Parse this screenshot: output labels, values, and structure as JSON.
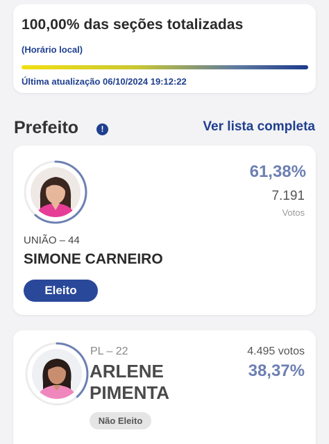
{
  "status": {
    "title": "100,00% das seções totalizadas",
    "local_time_label": "(Horário local)",
    "progress_percent": 100,
    "last_update": "Última atualização 06/10/2024 19:12:22",
    "progress_gradient": [
      "#f2df12",
      "#1c3a8c"
    ]
  },
  "section": {
    "title": "Prefeito",
    "info_icon": "info-icon",
    "see_all_label": "Ver lista completa"
  },
  "candidates": [
    {
      "party": "UNIÃO – 44",
      "name": "SIMONE CARNEIRO",
      "percent": "61,38%",
      "votes": "7.191",
      "votes_label": "Votos",
      "status_label": "Eleito",
      "ring_fraction": 0.6138,
      "ring_color": "#6d80b3"
    },
    {
      "party": "PL – 22",
      "name_line1": "ARLENE",
      "name_line2": "PIMENTA",
      "percent": "38,37%",
      "votes": "4.495 votos",
      "status_label": "Não Eleito",
      "ring_fraction": 0.3837,
      "ring_color": "#6d80b3"
    }
  ],
  "colors": {
    "accent": "#1f3f8f",
    "percent": "#6d80b3",
    "elected_badge": "#2a489a",
    "not_elected_badge": "#e5e5e5"
  }
}
